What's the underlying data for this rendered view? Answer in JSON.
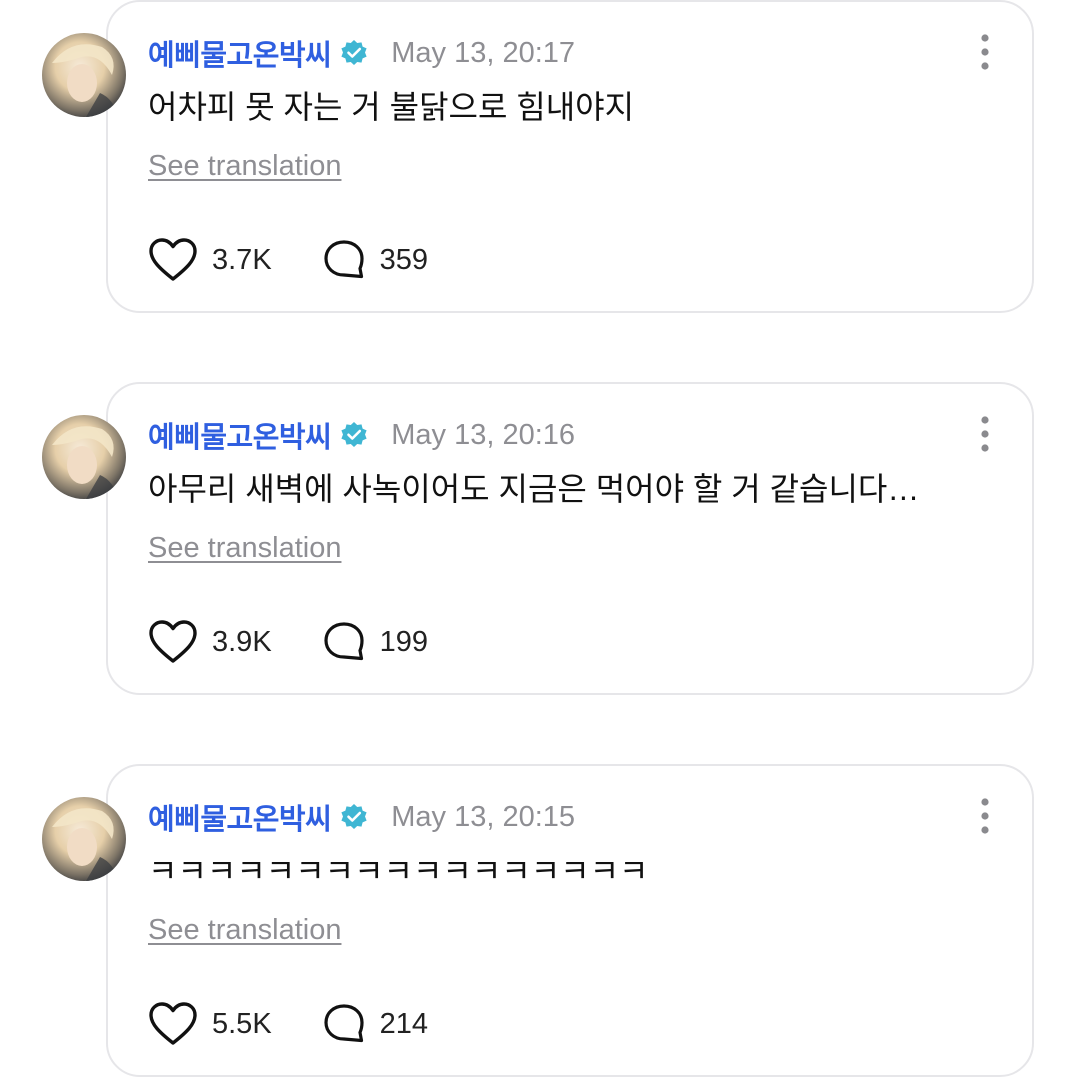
{
  "colors": {
    "author": "#2f5fe0",
    "verified_badge": "#3fb6d3",
    "muted": "#8e8e93",
    "card_border": "#e6e6e9"
  },
  "posts": [
    {
      "author": "예삐물고온박씨",
      "timestamp": "May 13, 20:17",
      "text": "어차피 못 자는 거 불닭으로 힘내야지",
      "translate_label": "See translation",
      "likes": "3.7K",
      "replies": "359"
    },
    {
      "author": "예삐물고온박씨",
      "timestamp": "May 13, 20:16",
      "text": "아무리 새벽에 사녹이어도 지금은 먹어야 할 거 같습니다…",
      "translate_label": "See translation",
      "likes": "3.9K",
      "replies": "199"
    },
    {
      "author": "예삐물고온박씨",
      "timestamp": "May 13, 20:15",
      "text": "ㅋㅋㅋㅋㅋㅋㅋㅋㅋㅋㅋㅋㅋㅋㅋㅋㅋ",
      "translate_label": "See translation",
      "likes": "5.5K",
      "replies": "214"
    }
  ],
  "icons": {
    "avatar": "avatar-photo",
    "verified": "verified-badge-icon",
    "more": "more-vertical-icon",
    "like": "heart-icon",
    "reply": "speech-bubble-icon"
  }
}
